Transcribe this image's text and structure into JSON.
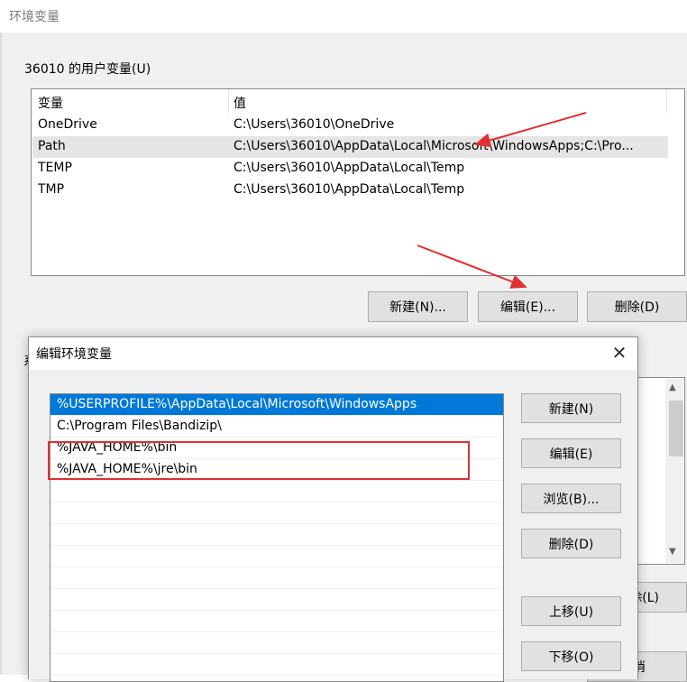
{
  "window": {
    "title": "环境变量"
  },
  "user_vars": {
    "label": "36010 的用户变量(U)",
    "headers": [
      "变量",
      "值"
    ],
    "rows": [
      {
        "name": "OneDrive",
        "value": "C:\\Users\\36010\\OneDrive"
      },
      {
        "name": "Path",
        "value": "C:\\Users\\36010\\AppData\\Local\\Microsoft\\WindowsApps;C:\\Pro..."
      },
      {
        "name": "TEMP",
        "value": "C:\\Users\\36010\\AppData\\Local\\Temp"
      },
      {
        "name": "TMP",
        "value": "C:\\Users\\36010\\AppData\\Local\\Temp"
      }
    ],
    "buttons": {
      "new": "新建(N)...",
      "edit": "编辑(E)...",
      "delete": "删除(D)"
    }
  },
  "system_vars": {
    "label_partial": "系",
    "button_partial_delete": "除(L)",
    "button_partial_cancel": "消"
  },
  "edit_dialog": {
    "title": "编辑环境变量",
    "close_glyph": "✕",
    "entries": [
      "%USERPROFILE%\\AppData\\Local\\Microsoft\\WindowsApps",
      "C:\\Program Files\\Bandizip\\",
      "%JAVA_HOME%\\bin",
      "%JAVA_HOME%\\jre\\bin"
    ],
    "buttons": {
      "new": "新建(N)",
      "edit": "编辑(E)",
      "browse": "浏览(B)...",
      "delete": "删除(D)",
      "move_up": "上移(U)",
      "move_down": "下移(O)"
    }
  },
  "annotation_colors": {
    "arrow": "#e03030",
    "box": "#e03030"
  }
}
